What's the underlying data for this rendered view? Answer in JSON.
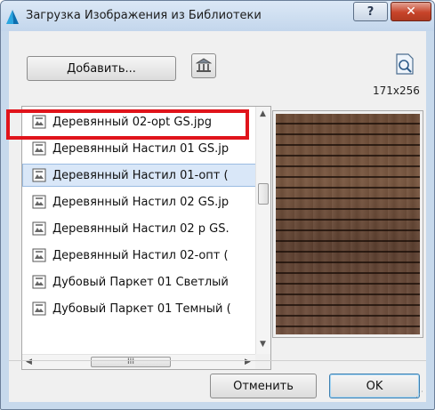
{
  "window": {
    "title": "Загрузка Изображения из Библиотеки",
    "help_label": "?",
    "close_label": "✕"
  },
  "toolbar": {
    "add_label": "Добавить...",
    "image_size": "171x256"
  },
  "file_list": {
    "items": [
      {
        "label": "Деревянный 02-opt GS.jpg",
        "selected": false
      },
      {
        "label": "Деревянный Настил 01 GS.jp",
        "selected": false
      },
      {
        "label": "Деревянный Настил 01-опт (",
        "selected": true
      },
      {
        "label": "Деревянный Настил 02 GS.jp",
        "selected": false
      },
      {
        "label": "Деревянный Настил 02 p GS.",
        "selected": false
      },
      {
        "label": "Деревянный Настил 02-опт (",
        "selected": false
      },
      {
        "label": "Дубовый Паркет 01 Светлый",
        "selected": false
      },
      {
        "label": "Дубовый Паркет 01 Темный (",
        "selected": false
      }
    ],
    "hscroll_grip": "III"
  },
  "footer": {
    "cancel_label": "Отменить",
    "ok_label": "OK"
  },
  "colors": {
    "highlight": "#e0141b",
    "selection": "#d9e7f8",
    "close_button": "#c7442a"
  }
}
